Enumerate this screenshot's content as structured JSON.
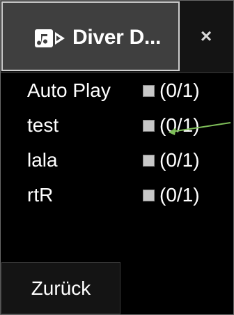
{
  "window": {
    "title": "Diver D...",
    "close_glyph": "×",
    "icon": "music-note-icon"
  },
  "options": [
    {
      "label": "Auto Play",
      "count": "(0/1)",
      "checked": false
    },
    {
      "label": "test",
      "count": "(0/1)",
      "checked": false
    },
    {
      "label": "lala",
      "count": "(0/1)",
      "checked": false
    },
    {
      "label": "rtR",
      "count": "(0/1)",
      "checked": false
    }
  ],
  "footer": {
    "back_label": "Zurück"
  },
  "annotation": {
    "type": "arrow",
    "color": "#7fbf5a",
    "points_to": "checkbox-test"
  },
  "colors": {
    "background": "#000000",
    "tab_active": "#3f3f3f",
    "bar": "#141414",
    "text": "#ffffff"
  }
}
